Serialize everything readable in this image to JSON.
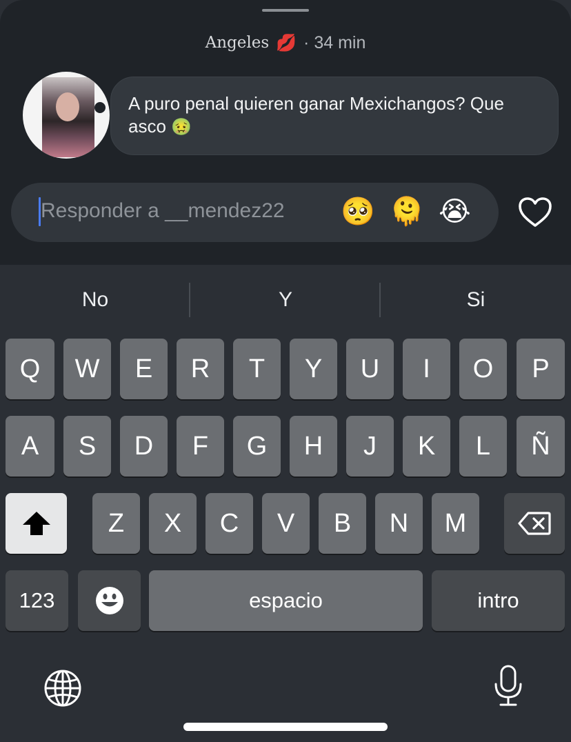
{
  "comment": {
    "author": "Angeles",
    "author_emoji": "💋",
    "separator": "·",
    "time": "34 min",
    "text": "A puro penal quieren ganar Mexichangos? Que asco",
    "text_emoji": "🤢"
  },
  "reply": {
    "placeholder": "Responder a __mendez22",
    "quick_reactions": [
      "🥺",
      "🫠",
      "😭"
    ]
  },
  "suggestions": [
    "No",
    "Y",
    "Si"
  ],
  "keyboard": {
    "row1": [
      "Q",
      "W",
      "E",
      "R",
      "T",
      "Y",
      "U",
      "I",
      "O",
      "P"
    ],
    "row2": [
      "A",
      "S",
      "D",
      "F",
      "G",
      "H",
      "J",
      "K",
      "L",
      "Ñ"
    ],
    "row3": [
      "Z",
      "X",
      "C",
      "V",
      "B",
      "N",
      "M"
    ],
    "numbers_label": "123",
    "space_label": "espacio",
    "return_label": "intro"
  }
}
